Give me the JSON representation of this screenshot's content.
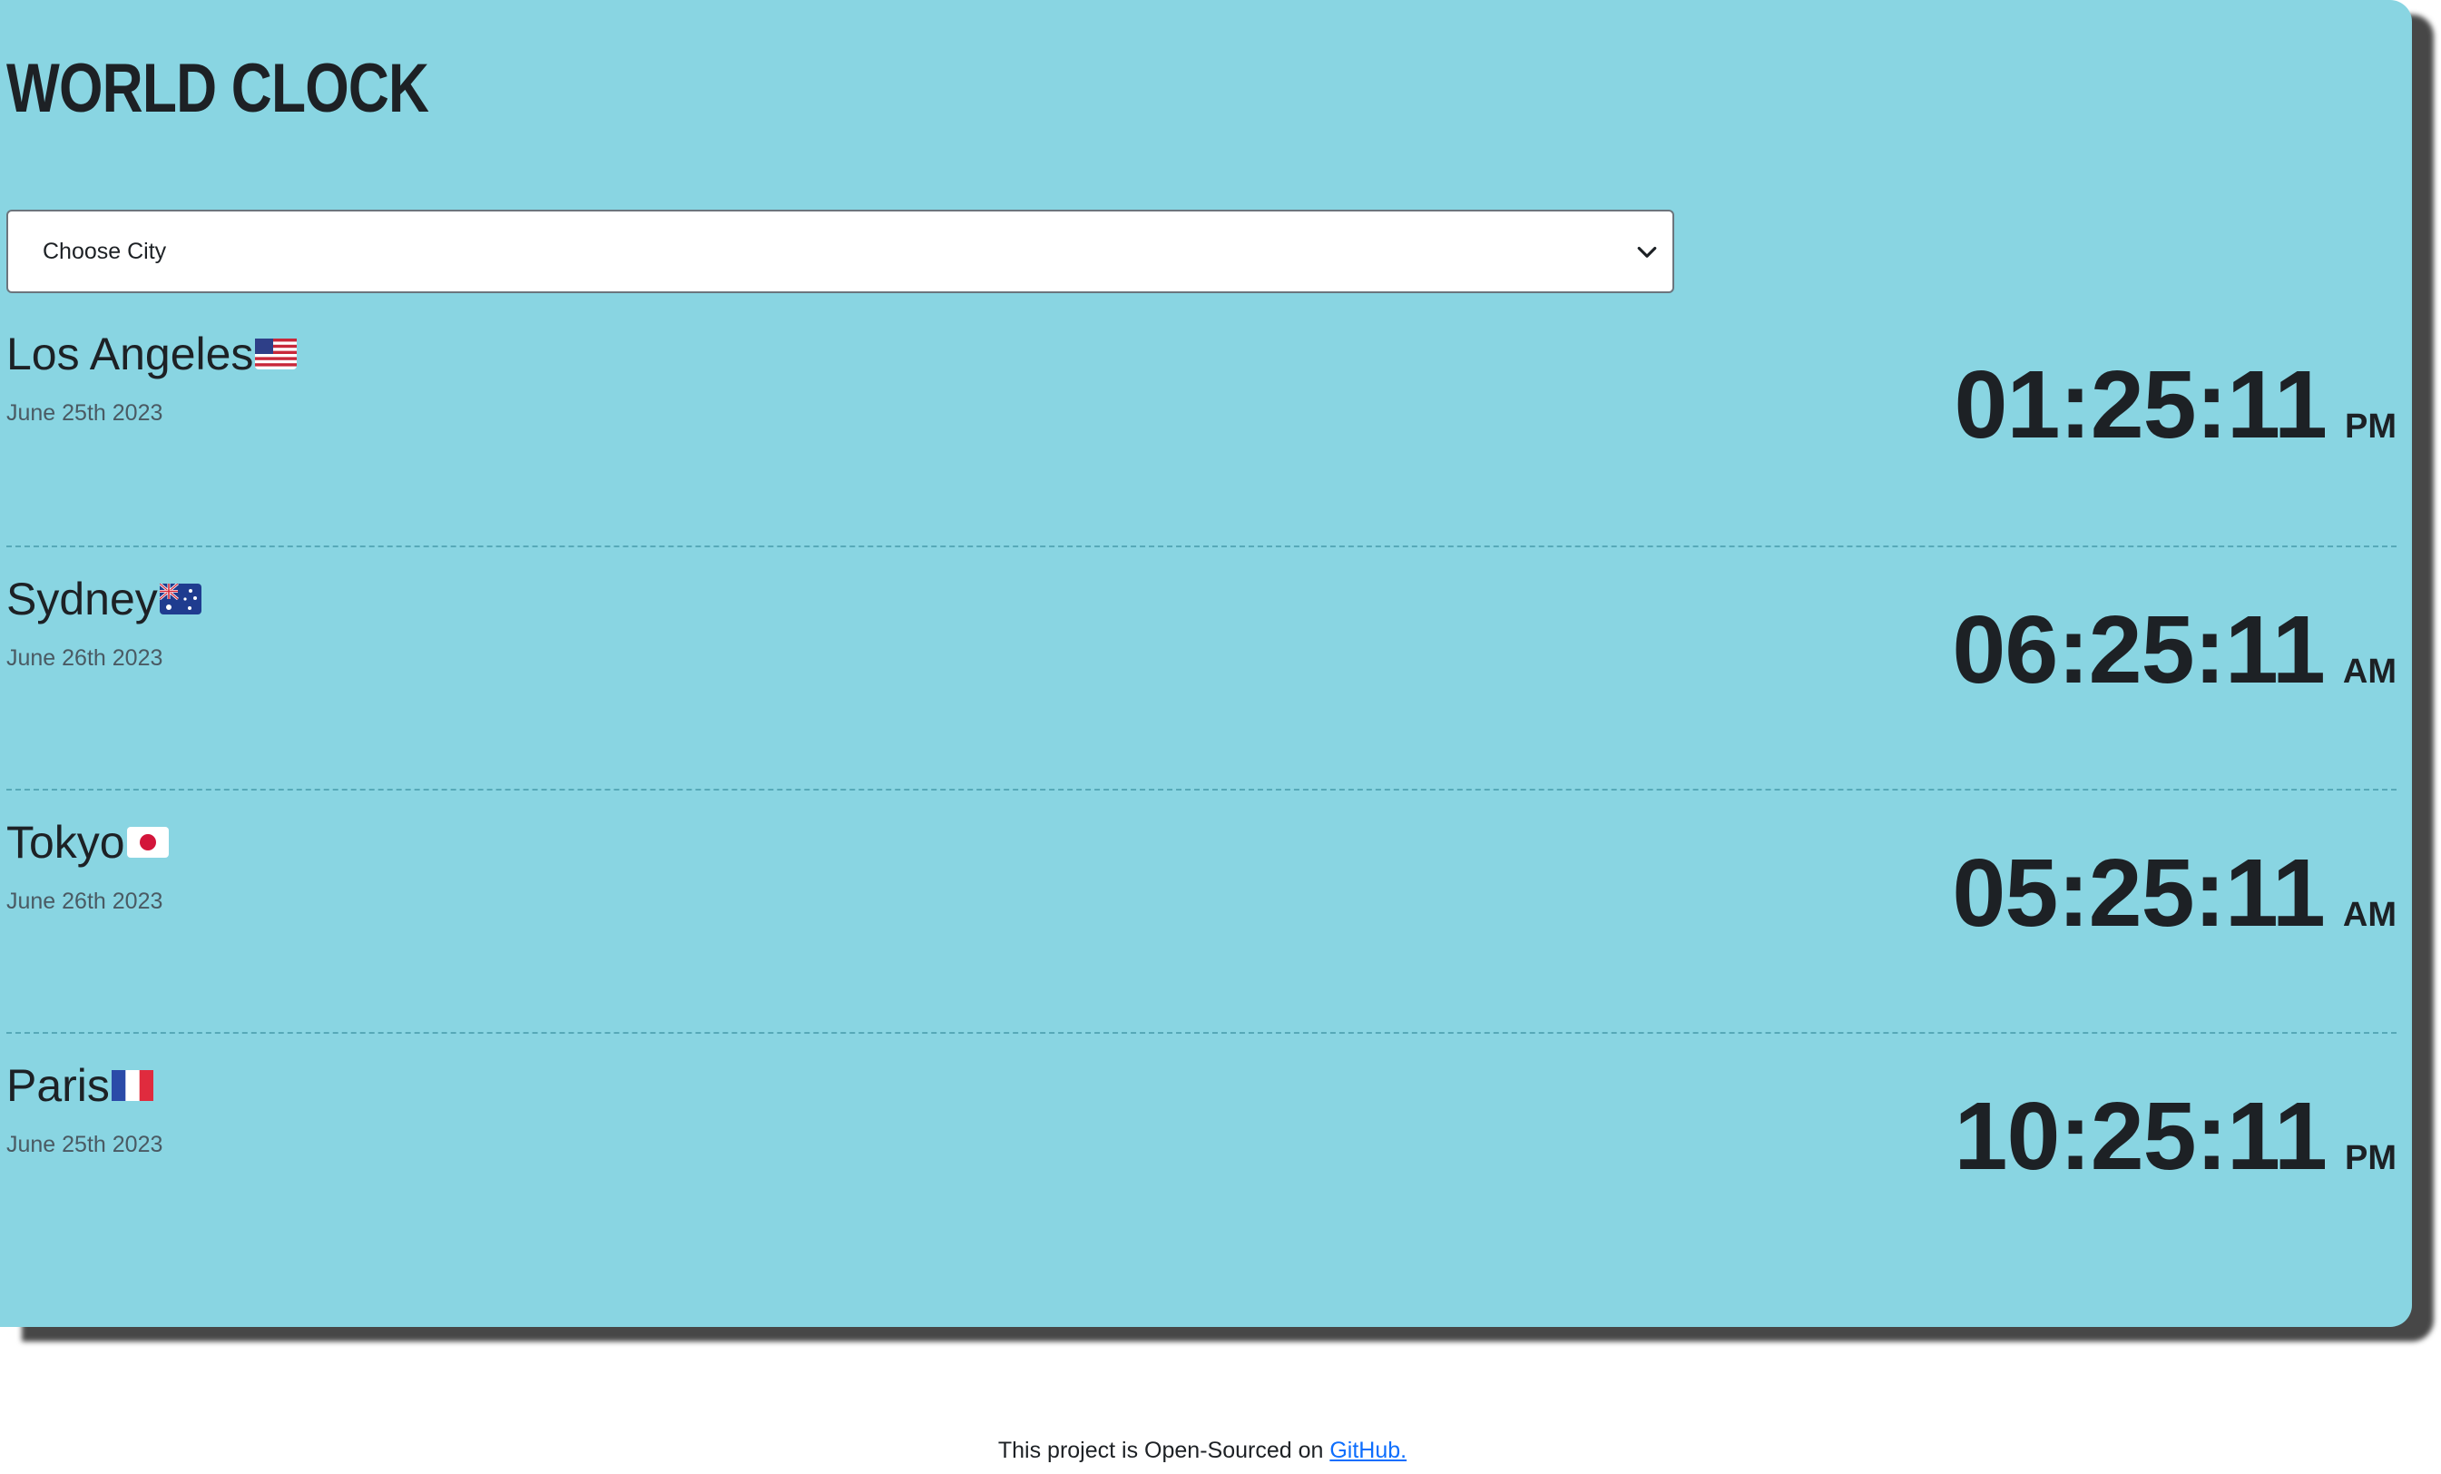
{
  "header": {
    "title": "WORLD CLOCK"
  },
  "city_select": {
    "selected": "Choose City"
  },
  "cities": [
    {
      "name": "Los Angeles",
      "flag": "us-flag-icon",
      "date": "June 25th 2023",
      "time": "01:25:11",
      "period": "PM"
    },
    {
      "name": "Sydney",
      "flag": "au-flag-icon",
      "date": "June 26th 2023",
      "time": "06:25:11",
      "period": "AM"
    },
    {
      "name": "Tokyo",
      "flag": "jp-flag-icon",
      "date": "June 26th 2023",
      "time": "05:25:11",
      "period": "AM"
    },
    {
      "name": "Paris",
      "flag": "fr-flag-icon",
      "date": "June 25th 2023",
      "time": "10:25:11",
      "period": "PM"
    }
  ],
  "footer": {
    "text": "This project is Open-Sourced on ",
    "link_label": "GitHub."
  },
  "colors": {
    "card_background": "#89d5e2",
    "text": "#1d2125",
    "link": "#0d6efd"
  }
}
